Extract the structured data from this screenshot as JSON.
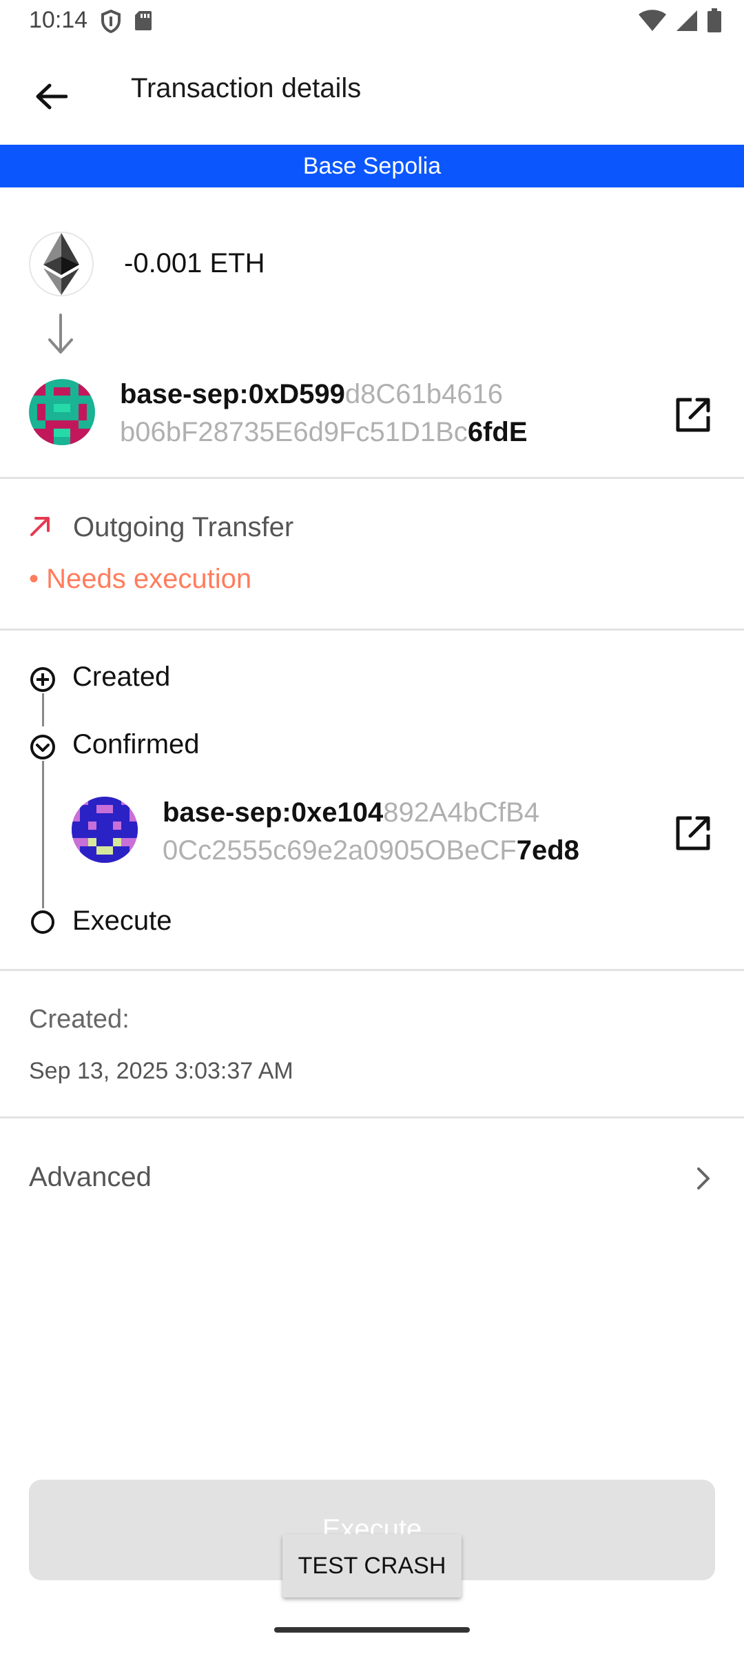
{
  "status_bar": {
    "time": "10:14",
    "left_icons": [
      "shield-icon",
      "sd-card-icon"
    ],
    "right_icons": [
      "wifi-icon",
      "signal-icon",
      "battery-icon"
    ]
  },
  "app_bar": {
    "title": "Transaction details",
    "back_icon": "arrow-left-icon"
  },
  "network": {
    "name": "Base Sepolia",
    "color": "#0b57fd"
  },
  "transfer": {
    "amount": "-0.001 ETH",
    "token_icon": "ethereum-icon",
    "recipient": {
      "prefix_bold": "base-sep:0xD599",
      "middle_line1": "d8C61b4616",
      "middle_line2": "b06bF28735E6d9Fc51D1Bc",
      "suffix_bold": "6fdE"
    }
  },
  "transaction": {
    "type_label": "Outgoing Transfer",
    "type_icon": "arrow-up-right-icon",
    "status": "• Needs execution",
    "status_color": "#ff7c5c"
  },
  "timeline": {
    "created": "Created",
    "confirmed": "Confirmed",
    "execute": "Execute",
    "signer": {
      "prefix_bold": "base-sep:0xe104",
      "middle_line1": "892A4bCfB4",
      "middle_line2": "0Cc2555c69e2a0905OBeCF",
      "suffix_bold": "7ed8"
    }
  },
  "details": {
    "created_label": "Created:",
    "created_value": "Sep 13, 2025 3:03:37 AM"
  },
  "advanced": {
    "label": "Advanced"
  },
  "actions": {
    "execute_label": "Execute",
    "test_crash_label": "TEST CRASH"
  }
}
